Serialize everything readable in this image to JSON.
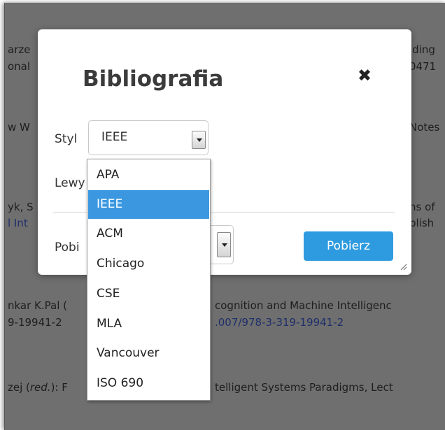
{
  "background": {
    "lines": [
      {
        "text": "arze",
        "id": "l1"
      },
      {
        "text": "onal",
        "id": "l2"
      },
      {
        "text": "lding",
        "id": "r1"
      },
      {
        "text": "0471",
        "id": "r2"
      },
      {
        "text": "w W",
        "id": "l3"
      },
      {
        "text": "Notes",
        "id": "r3"
      },
      {
        "text": "yk, S",
        "id": "l4"
      },
      {
        "text": "l Int",
        "id": "l5"
      },
      {
        "text": "ns of",
        "id": "r4"
      },
      {
        "text": "blish",
        "id": "r5"
      },
      {
        "text": "nkar K.Pal (",
        "id": "l6"
      },
      {
        "text": "cognition and Machine Intelligenc",
        "id": "r6"
      },
      {
        "text": "9-19941-2",
        "id": "l7"
      },
      {
        "text": ".007/978-3-319-19941-2",
        "id": "r7"
      },
      {
        "text": "zej (",
        "id": "l8a"
      },
      {
        "text": "red.",
        "id": "l8b"
      },
      {
        "text": "): F",
        "id": "l8c"
      },
      {
        "text": "telligent Systems Paradigms, Lect",
        "id": "r8"
      }
    ]
  },
  "modal": {
    "title": "Bibliografia",
    "close_icon": "close-icon",
    "style_label": "Styl",
    "style_value": "IEEE",
    "left_label": "Lewy",
    "download_label": "Pobi",
    "download_button": "Pobierz"
  },
  "dropdown": {
    "options": [
      "APA",
      "IEEE",
      "ACM",
      "Chicago",
      "CSE",
      "MLA",
      "Vancouver",
      "ISO 690"
    ],
    "selected": "IEEE"
  },
  "colors": {
    "accent": "#2e9be0",
    "selected_option": "#3b98e0",
    "overlay": "#6f6f6f",
    "link": "#1f2f6a"
  }
}
